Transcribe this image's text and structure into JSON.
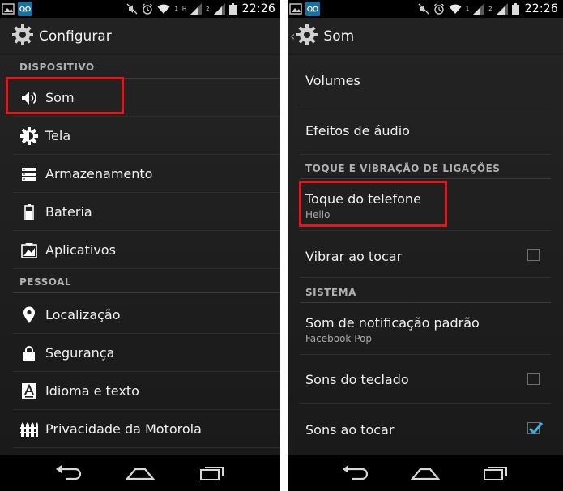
{
  "status_bar": {
    "time": "22:26",
    "signal_label_1": "1",
    "signal_label_2": "2",
    "network_letter": "H"
  },
  "left_screen": {
    "title": "Configurar",
    "sections": [
      {
        "label": "DISPOSITIVO",
        "items": [
          {
            "label": "Som",
            "icon": "speaker-icon"
          },
          {
            "label": "Tela",
            "icon": "brightness-icon"
          },
          {
            "label": "Armazenamento",
            "icon": "storage-icon"
          },
          {
            "label": "Bateria",
            "icon": "battery-icon"
          },
          {
            "label": "Aplicativos",
            "icon": "apps-icon"
          }
        ]
      },
      {
        "label": "PESSOAL",
        "items": [
          {
            "label": "Localização",
            "icon": "location-pin-icon"
          },
          {
            "label": "Segurança",
            "icon": "lock-icon"
          },
          {
            "label": "Idioma e texto",
            "icon": "language-icon"
          },
          {
            "label": "Privacidade da Motorola",
            "icon": "privacy-fence-icon"
          }
        ]
      }
    ]
  },
  "right_screen": {
    "title": "Som",
    "items": {
      "volumes": {
        "title": "Volumes"
      },
      "audio_effects": {
        "title": "Efeitos de áudio"
      },
      "ringtone": {
        "title": "Toque do telefone",
        "summary": "Hello"
      },
      "vibrate_on_ring": {
        "title": "Vibrar ao tocar",
        "checked": false
      },
      "default_notification": {
        "title": "Som de notificação padrão",
        "summary": "Facebook Pop"
      },
      "keyboard_sounds": {
        "title": "Sons do teclado",
        "checked": false
      },
      "touch_sounds": {
        "title": "Sons ao tocar",
        "checked": true
      }
    },
    "sections": {
      "call_ring_vibration": "TOQUE E VIBRAÇÃO DE LIGAÇÕES",
      "system": "SISTEMA"
    }
  },
  "colors": {
    "highlight": "#e0181b",
    "checkbox_check": "#33b5e5",
    "voicemail_icon": "#33b5e5",
    "background": "#1e1e1e",
    "action_bar": "#222222"
  }
}
